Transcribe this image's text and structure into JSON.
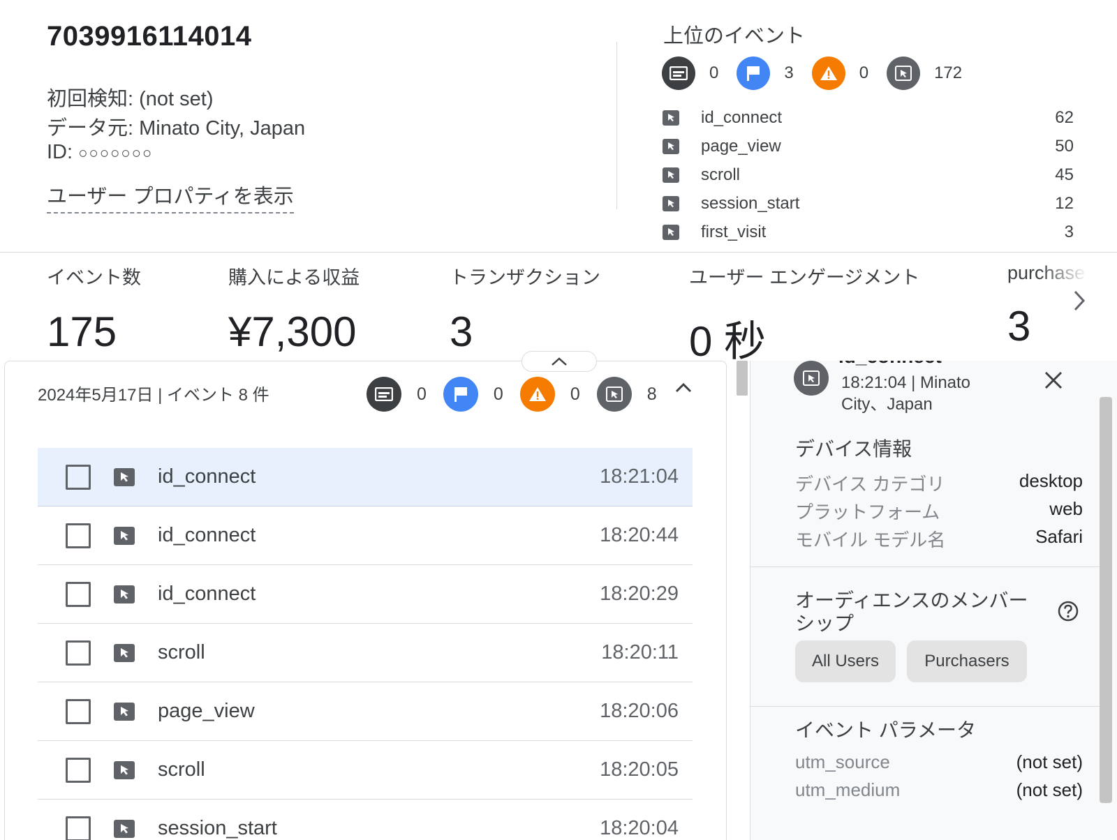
{
  "user": {
    "id": "7039916114014",
    "first_seen": "初回検知: (not set)",
    "source": "データ元: Minato City, Japan",
    "id_label": "ID:",
    "id_dots": "○○○○○○○",
    "props_link": "ユーザー プロパティを表示"
  },
  "top_events": {
    "title": "上位のイベント",
    "types": [
      {
        "icon": "screen-icon",
        "color": "#3c4043",
        "count": "0"
      },
      {
        "icon": "flag-icon",
        "color": "#4285f4",
        "count": "3"
      },
      {
        "icon": "warning-icon",
        "color": "#f57c00",
        "count": "0"
      },
      {
        "icon": "cursor-icon",
        "color": "#5f6368",
        "count": "172"
      }
    ],
    "list": [
      {
        "name": "id_connect",
        "count": "62"
      },
      {
        "name": "page_view",
        "count": "50"
      },
      {
        "name": "scroll",
        "count": "45"
      },
      {
        "name": "session_start",
        "count": "12"
      },
      {
        "name": "first_visit",
        "count": "3"
      }
    ]
  },
  "metrics": [
    {
      "label": "イベント数",
      "value": "175"
    },
    {
      "label": "購入による収益",
      "value": "¥7,300"
    },
    {
      "label": "トランザクション",
      "value": "3"
    },
    {
      "label": "ユーザー エンゲージメント",
      "value": "0 秒"
    },
    {
      "label": "purchase",
      "value": "3"
    }
  ],
  "timeline": {
    "header": "2024年5月17日 | イベント 8 件",
    "types": [
      {
        "icon": "screen-icon",
        "color": "#3c4043",
        "count": "0"
      },
      {
        "icon": "flag-icon",
        "color": "#4285f4",
        "count": "0"
      },
      {
        "icon": "warning-icon",
        "color": "#f57c00",
        "count": "0"
      },
      {
        "icon": "cursor-icon",
        "color": "#5f6368",
        "count": "8"
      }
    ],
    "events": [
      {
        "name": "id_connect",
        "time": "18:21:04",
        "selected": true
      },
      {
        "name": "id_connect",
        "time": "18:20:44"
      },
      {
        "name": "id_connect",
        "time": "18:20:29"
      },
      {
        "name": "scroll",
        "time": "18:20:11"
      },
      {
        "name": "page_view",
        "time": "18:20:06"
      },
      {
        "name": "scroll",
        "time": "18:20:05"
      },
      {
        "name": "session_start",
        "time": "18:20:04"
      }
    ]
  },
  "detail": {
    "title": "id_connect",
    "subtitle": "18:21:04 | Minato City、Japan",
    "device_title": "デバイス情報",
    "device": [
      {
        "key": "デバイス カテゴリ",
        "value": "desktop"
      },
      {
        "key": "プラットフォーム",
        "value": "web"
      },
      {
        "key": "モバイル モデル名",
        "value": "Safari"
      }
    ],
    "audience_title": "オーディエンスのメンバーシップ",
    "audiences": [
      "All Users",
      "Purchasers"
    ],
    "params_title": "イベント パラメータ",
    "params": [
      {
        "key": "utm_source",
        "value": "(not set)"
      },
      {
        "key": "utm_medium",
        "value": "(not set)"
      }
    ]
  }
}
